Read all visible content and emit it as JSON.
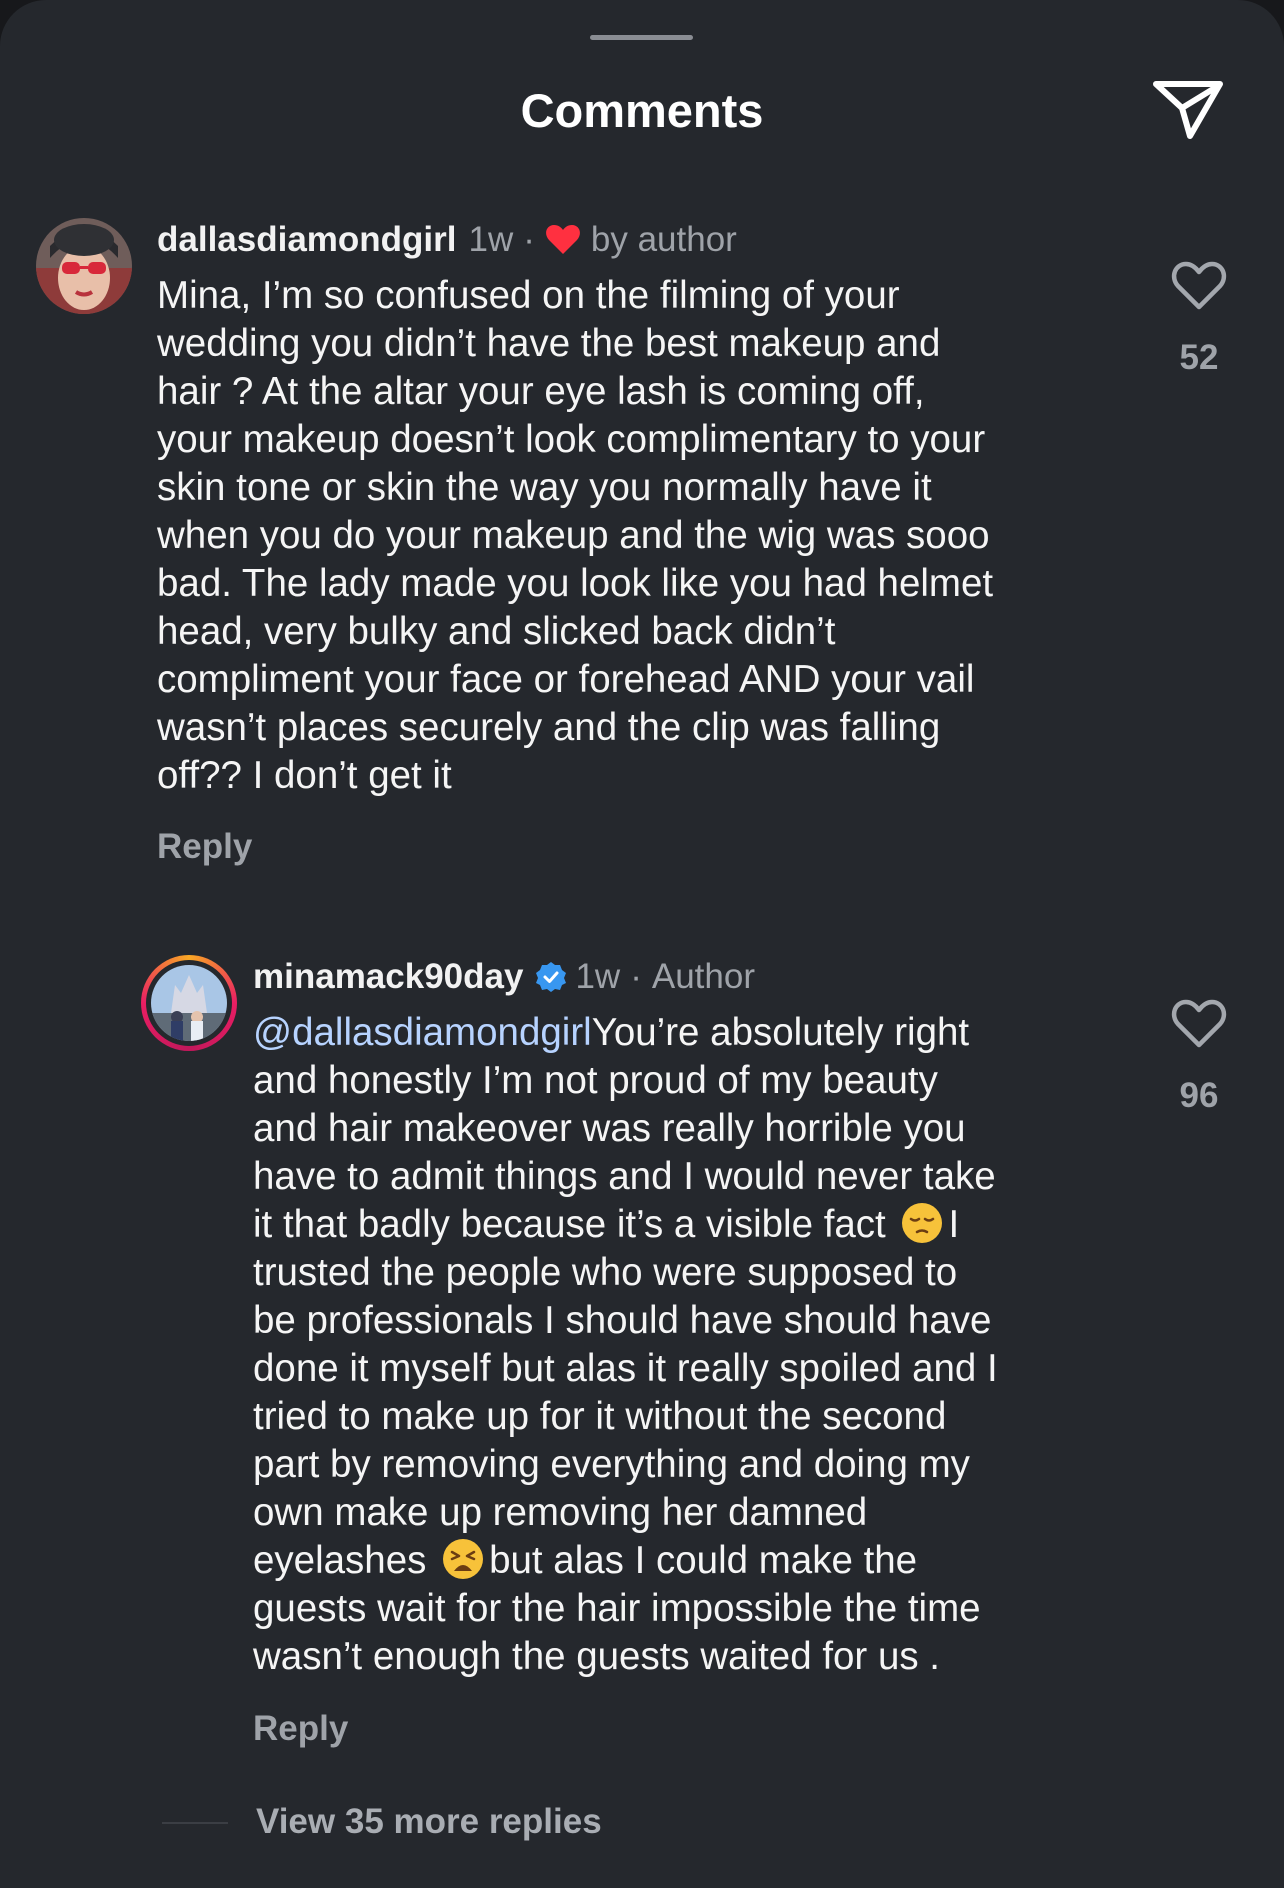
{
  "header": {
    "title": "Comments",
    "share_icon": "paper-plane-icon"
  },
  "comments": [
    {
      "username": "dallasdiamondgirl",
      "time": "1w",
      "separator": "·",
      "liked_by_author_icon": "red-heart-icon",
      "liked_by_author_text": "by author",
      "body_lines": [
        "Mina, I’m so confused on the filming of your",
        "wedding you didn’t have the best makeup and",
        "hair ? At the altar your eye lash is coming off,",
        "your makeup doesn’t look complimentary to your",
        "skin tone or skin the way you normally have it",
        "when you do your makeup and the wig was sooo",
        "bad. The lady made you look like you had helmet",
        "head,  very bulky and slicked back didn’t",
        "compliment your face or forehead AND your vail",
        "wasn’t places securely and the clip was falling",
        "off?? I don’t get it"
      ],
      "reply_label": "Reply",
      "like_count": "52"
    },
    {
      "username": "minamack90day",
      "verified_icon": "verified-badge-icon",
      "time": "1w",
      "separator": "·",
      "role": "Author",
      "mention": "@dallasdiamondgirl",
      "body_lines": [
        "You’re absolutely right",
        "and honestly I’m not proud of my beauty",
        "and hair makeover was really horrible you",
        "have to admit things and I would never take",
        "it that badly because it’s a visible fact ",
        "I",
        "trusted the people who were supposed to",
        "be professionals I should have should have",
        "done it myself but alas it really spoiled and I",
        "tried to make up for it without the second",
        "part by removing everything and doing my",
        "own make up removing her damned",
        "eyelashes ",
        "but alas I could make the",
        "guests wait for the hair impossible the time",
        "wasn’t enough the guests waited for us ."
      ],
      "emojis": [
        "pensive-face-emoji",
        "weary-face-emoji"
      ],
      "reply_label": "Reply",
      "like_count": "96"
    }
  ],
  "view_more": "View 35 more replies",
  "colors": {
    "background": "#25282d",
    "text": "#f5f5f5",
    "secondary_text": "#9fa3a9",
    "mention": "#b7d3ff",
    "verified": "#3897f0",
    "heart_red": "#ff3040"
  }
}
